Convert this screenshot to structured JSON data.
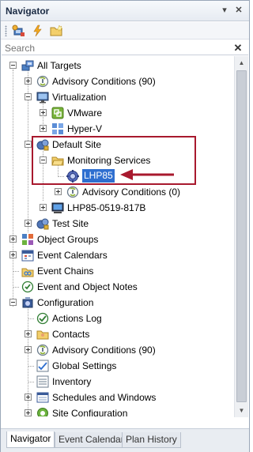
{
  "panel": {
    "title": "Navigator",
    "pin_glyph": "▾",
    "close_glyph": "✕"
  },
  "toolbar": {
    "buttons": [
      {
        "icon": "targets-add-icon"
      },
      {
        "icon": "lightning-icon"
      },
      {
        "icon": "folder-new-icon"
      }
    ]
  },
  "search": {
    "placeholder": "Search",
    "value": "",
    "clear_glyph": "✕"
  },
  "tree": {
    "nodes": [
      {
        "label": "All Targets",
        "icon": "all-targets-icon",
        "toggle": "minus"
      },
      {
        "label": "Advisory Conditions (90)",
        "icon": "advisory-icon",
        "toggle": "plus"
      },
      {
        "label": "Virtualization",
        "icon": "monitor-icon",
        "toggle": "minus"
      },
      {
        "label": "VMware",
        "icon": "vmware-icon",
        "toggle": "plus"
      },
      {
        "label": "Hyper-V",
        "icon": "hyperv-icon",
        "toggle": "plus"
      },
      {
        "label": "Default Site",
        "icon": "site-icon",
        "toggle": "minus"
      },
      {
        "label": "Monitoring Services",
        "icon": "folder-icon",
        "toggle": "minus"
      },
      {
        "label": "LHP85",
        "icon": "gear-icon",
        "toggle": "none",
        "selected": true
      },
      {
        "label": "Advisory Conditions (0)",
        "icon": "advisory-icon",
        "toggle": "plus"
      },
      {
        "label": "LHP85-0519-817B",
        "icon": "computer-icon",
        "toggle": "plus"
      },
      {
        "label": "Test Site",
        "icon": "site-icon",
        "toggle": "plus"
      },
      {
        "label": "Object Groups",
        "icon": "object-groups-icon",
        "toggle": "plus"
      },
      {
        "label": "Event Calendars",
        "icon": "calendar-icon",
        "toggle": "plus"
      },
      {
        "label": "Event Chains",
        "icon": "event-chains-icon",
        "toggle": "none"
      },
      {
        "label": "Event and Object Notes",
        "icon": "notes-icon",
        "toggle": "none"
      },
      {
        "label": "Configuration",
        "icon": "configuration-icon",
        "toggle": "minus"
      },
      {
        "label": "Actions Log",
        "icon": "actions-log-icon",
        "toggle": "none"
      },
      {
        "label": "Contacts",
        "icon": "contacts-icon",
        "toggle": "plus"
      },
      {
        "label": "Advisory Conditions (90)",
        "icon": "advisory-icon",
        "toggle": "plus"
      },
      {
        "label": "Global Settings",
        "icon": "settings-icon",
        "toggle": "none"
      },
      {
        "label": "Inventory",
        "icon": "inventory-icon",
        "toggle": "none"
      },
      {
        "label": "Schedules and Windows",
        "icon": "schedules-icon",
        "toggle": "plus"
      },
      {
        "label": "Site Configuration",
        "icon": "site-config-icon",
        "toggle": "plus"
      }
    ]
  },
  "tabs": [
    {
      "label": "Navigator",
      "active": true
    },
    {
      "label": "Event Calendar",
      "active": false
    },
    {
      "label": "Plan History",
      "active": false
    }
  ],
  "colors": {
    "selection": "#2f6fd0",
    "highlight_box": "#a8192e",
    "arrow": "#a8192e"
  }
}
